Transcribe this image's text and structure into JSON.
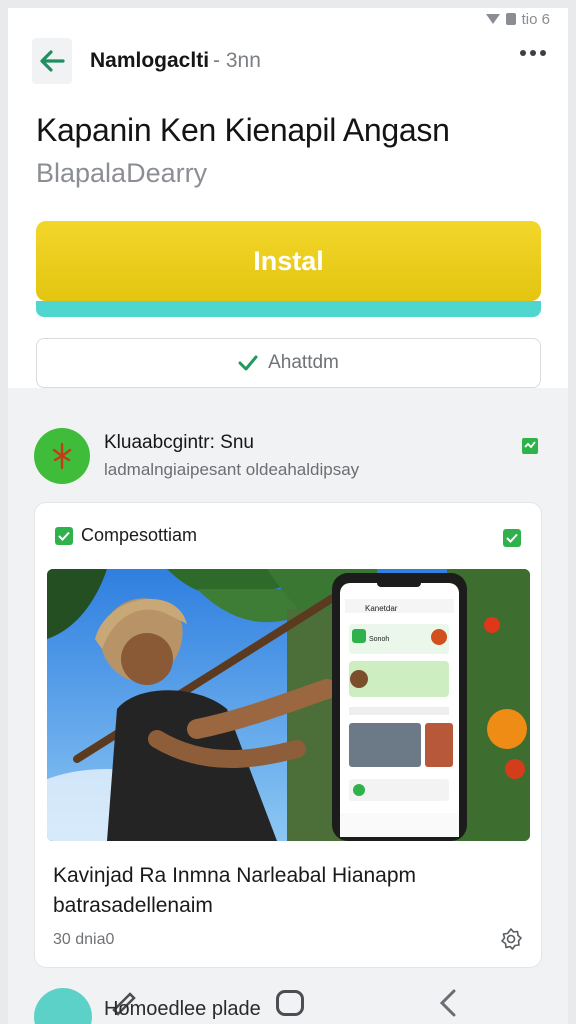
{
  "status": {
    "time": "tio 6"
  },
  "header": {
    "title": "Namlogaclti",
    "subtitle": "- 3nn"
  },
  "app": {
    "name": "Kapanin Ken Kienapil Angasn",
    "developer": "BlapalaDearry",
    "install_label": "Instal",
    "added_label": "Ahattdm"
  },
  "promo": {
    "name": "Kluaabcgintr: Snu",
    "description": "ladmalngiaipesant oldeahaldipsay"
  },
  "card": {
    "tag": "Compesottiam",
    "headline": "Kavinjad Ra Inmna Narleabal Hianapm batrasadellenaim",
    "meta": "30 dnia0",
    "phone_header": "Kanetdar",
    "phone_row": "Sonoh"
  },
  "bottom": {
    "label": "Homoedlee plade"
  },
  "colors": {
    "accent": "#1f8f5f",
    "install": "#e8cb17",
    "progress": "#4fd6cf",
    "check": "#2fb24c"
  }
}
